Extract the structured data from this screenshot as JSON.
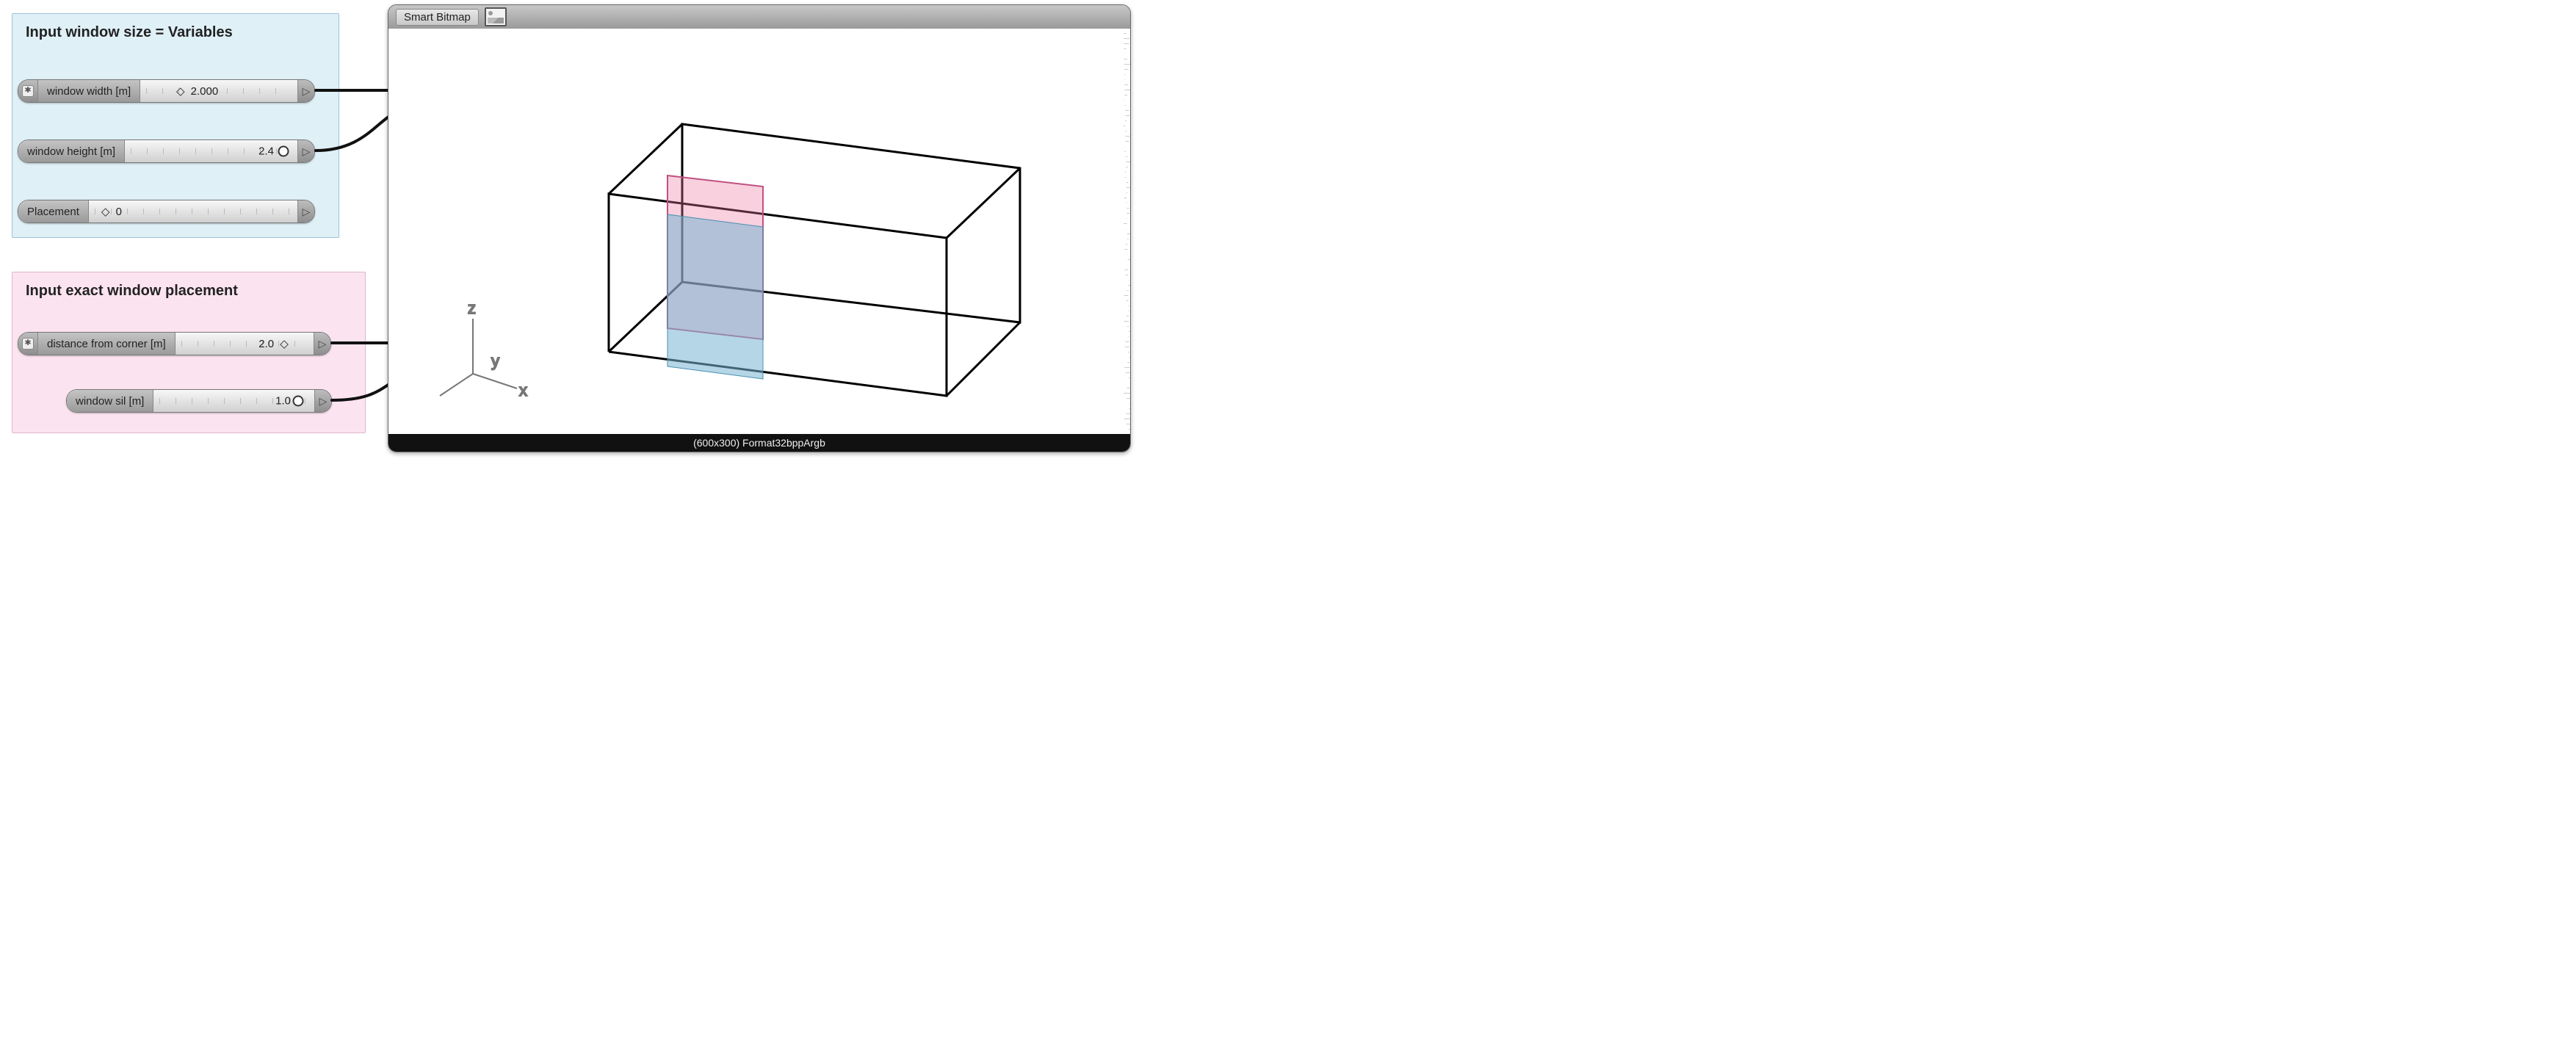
{
  "panels": {
    "size": {
      "title": "Input window size = Variables",
      "width": {
        "label": "window width [m]",
        "value": "2.000",
        "marker": "diamond",
        "has_star_cap": true,
        "marker_pos_pct": 40
      },
      "height": {
        "label": "window height [m]",
        "value": "2.4",
        "marker": "ring",
        "has_star_cap": false,
        "marker_pos_pct": 92
      },
      "place": {
        "label": "Placement",
        "value": "0",
        "marker": "diamond",
        "has_star_cap": false,
        "marker_pos_pct": 6
      }
    },
    "placement": {
      "title": "Input exact window placement",
      "dist": {
        "label": "distance from corner [m]",
        "value": "2.0",
        "marker": "diamond",
        "has_star_cap": true,
        "marker_pos_pct": 70
      },
      "sill": {
        "label": "window sil [m]",
        "value": "1.0",
        "marker": "ring",
        "has_star_cap": false,
        "marker_pos_pct": 90
      }
    }
  },
  "viewer": {
    "title": "Smart Bitmap",
    "status": "(600x300) Format32bppArgb",
    "axis_labels": {
      "x": "x",
      "y": "y",
      "z": "z"
    }
  }
}
